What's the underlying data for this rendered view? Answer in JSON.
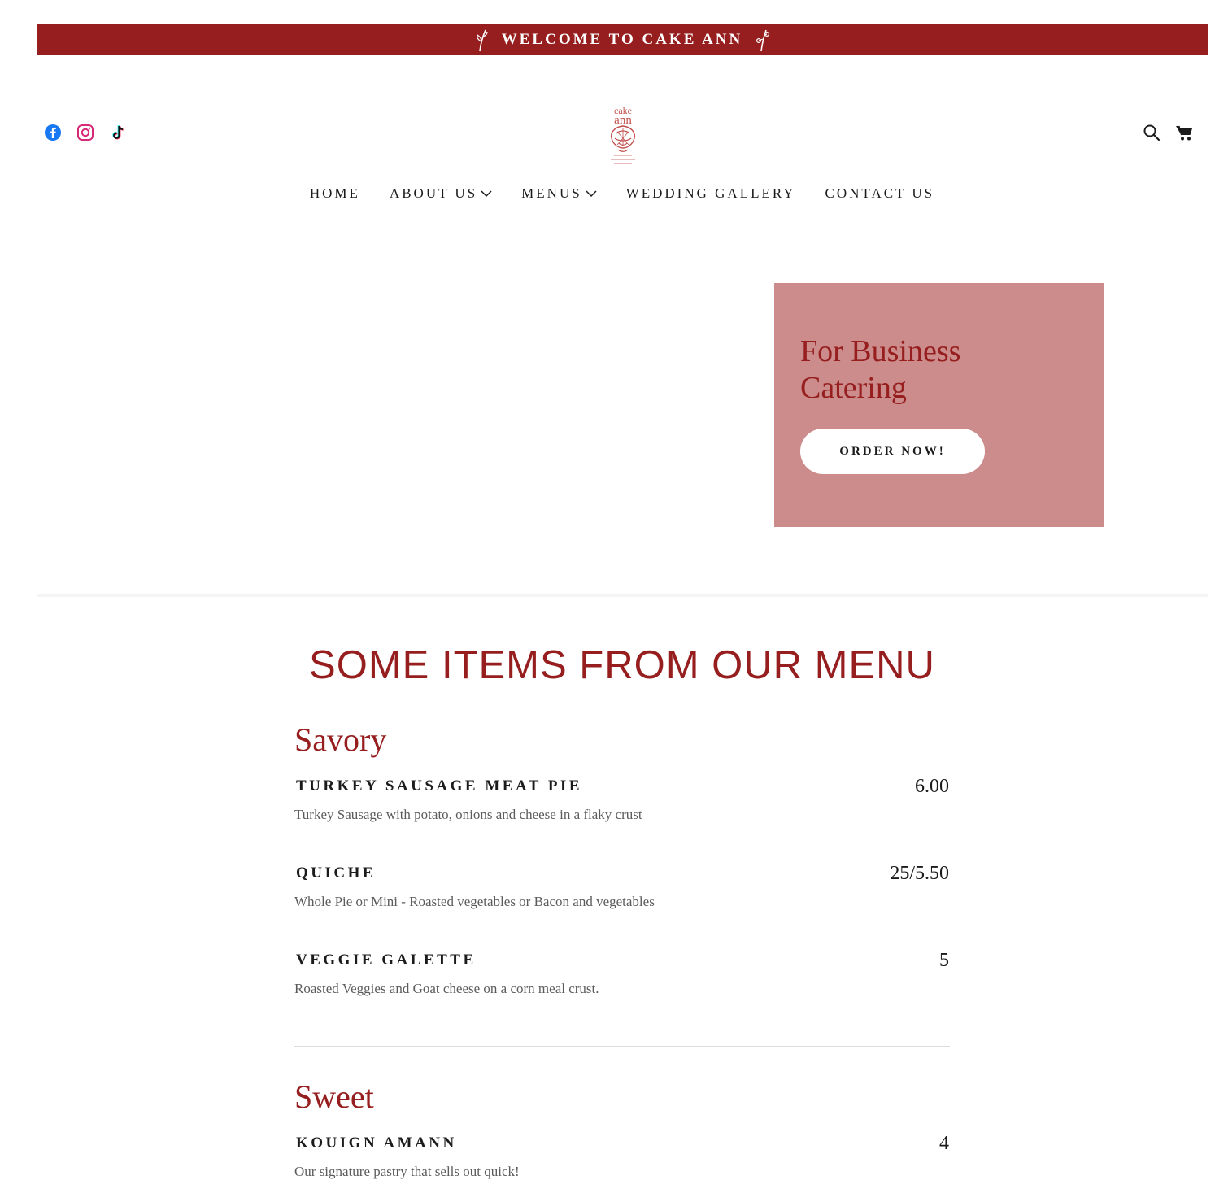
{
  "banner": {
    "text": "WELCOME TO CAKE ANN"
  },
  "header": {
    "social_icons": [
      "facebook-icon",
      "instagram-icon",
      "tiktok-icon"
    ],
    "right_icons": [
      "search-icon",
      "cart-icon"
    ],
    "logo_text": "cake ann"
  },
  "nav": {
    "items": [
      {
        "label": "HOME",
        "has_dropdown": false
      },
      {
        "label": "ABOUT US",
        "has_dropdown": true
      },
      {
        "label": "MENUS",
        "has_dropdown": true
      },
      {
        "label": "WEDDING GALLERY",
        "has_dropdown": false
      },
      {
        "label": "CONTACT US",
        "has_dropdown": false
      }
    ]
  },
  "promo": {
    "title_line1": "For Business",
    "title_line2": "Catering",
    "button_label": "ORDER NOW!"
  },
  "menu": {
    "heading": "SOME ITEMS FROM OUR MENU",
    "sections": [
      {
        "title": "Savory",
        "items": [
          {
            "name": "TURKEY SAUSAGE MEAT PIE",
            "price": "6.00",
            "description": "Turkey Sausage with potato, onions and cheese in a flaky crust"
          },
          {
            "name": "QUICHE",
            "price": "25/5.50",
            "description": "Whole Pie or Mini - Roasted vegetables or Bacon and vegetables"
          },
          {
            "name": "VEGGIE GALETTE",
            "price": "5",
            "description": "Roasted Veggies and Goat cheese on a corn meal crust."
          }
        ]
      },
      {
        "title": "Sweet",
        "items": [
          {
            "name": "KOUIGN AMANN",
            "price": "4",
            "description": "Our signature pastry that sells out quick!"
          }
        ]
      }
    ]
  },
  "colors": {
    "brand_red": "#961e1e",
    "promo_pink": "#cc8c8c"
  }
}
